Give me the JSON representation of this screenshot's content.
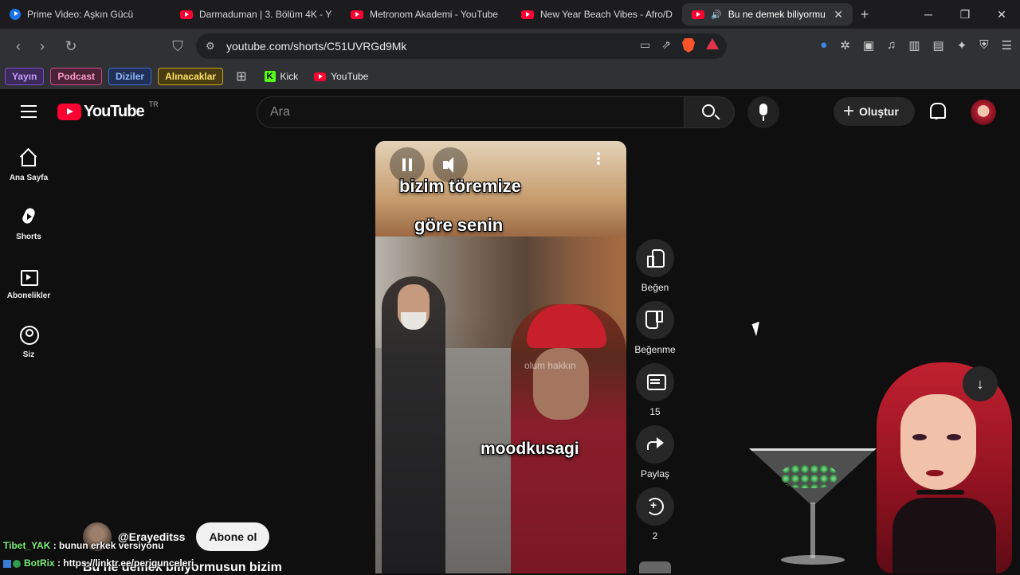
{
  "browser": {
    "tabs": [
      {
        "title": "Prime Video: Aşkın Gücü",
        "active": false
      },
      {
        "title": "Darmaduman | 3. Bölüm 4K - Yo",
        "active": false
      },
      {
        "title": "Metronom Akademi - YouTube",
        "active": false
      },
      {
        "title": "New Year Beach Vibes - Afro/D",
        "active": false
      },
      {
        "title": "Bu ne demek biliyormu",
        "active": true
      }
    ],
    "url": "youtube.com/shorts/C51UVRGd9Mk",
    "bookmarks": [
      "Yayın",
      "Podcast",
      "Diziler",
      "Alınacaklar"
    ],
    "bookmark_links": [
      "Kick",
      "YouTube"
    ]
  },
  "youtube": {
    "logo_text": "YouTube",
    "region": "TR",
    "search_placeholder": "Ara",
    "create_label": "Oluştur",
    "sidebar": [
      {
        "label": "Ana Sayfa",
        "icon": "home-icon"
      },
      {
        "label": "Shorts",
        "icon": "shorts-icon"
      },
      {
        "label": "Abonelikler",
        "icon": "subscriptions-icon"
      },
      {
        "label": "Siz",
        "icon": "you-icon"
      }
    ]
  },
  "short": {
    "captions": [
      "bizim töremize",
      "göre senin",
      "moodkusagi"
    ],
    "watermark": "olum hakkın",
    "actions": {
      "like": "Beğen",
      "dislike": "Beğenme",
      "comments": "15",
      "share": "Paylaş",
      "remix": "2"
    },
    "channel": "@Erayeditss",
    "subscribe": "Abone ol",
    "title": "Bu ne demek biliyormusun bizim"
  },
  "chat": [
    {
      "user": "Tibet_YAK",
      "message": " : bunun erkek versiyonu"
    },
    {
      "user": "BotRix",
      "message": " : https://linktr.ee/perigunceleri"
    }
  ]
}
